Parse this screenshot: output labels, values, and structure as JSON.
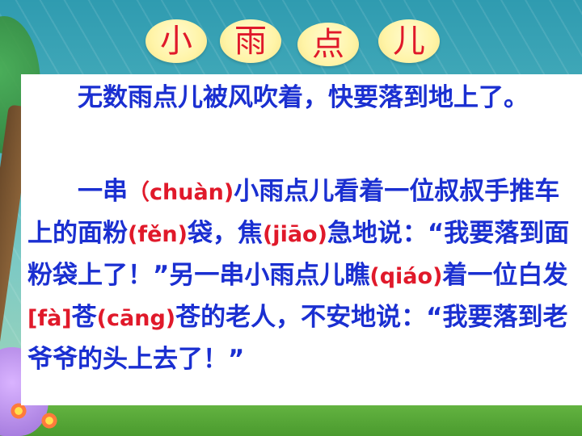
{
  "title": {
    "chars": [
      "小",
      "雨",
      "点",
      "儿"
    ]
  },
  "colors": {
    "title": "#e0192a",
    "text": "#1a2fd1",
    "pinyin": "#e0192a"
  },
  "paragraph1": "无数雨点儿被风吹着，快要落到地上了。",
  "paragraph2": {
    "t1": "一串",
    "py_chuan": "（chuàn)",
    "t2": "小雨点儿看着一位叔叔手推车上的面粉",
    "py_fen": "(fěn)",
    "t3": "袋，焦",
    "py_jiao": "(jiāo)",
    "t4": "急地说：“我要落到面粉袋上了！”另一串小雨点儿瞧",
    "py_qiao": "(qiáo)",
    "t5": "着一位白发",
    "py_fa": "[fà]",
    "t6": "苍",
    "py_cang": "(cāng)",
    "t7": "苍的老人，不安地说：“我要落到老爷爷的头上去了！”"
  }
}
